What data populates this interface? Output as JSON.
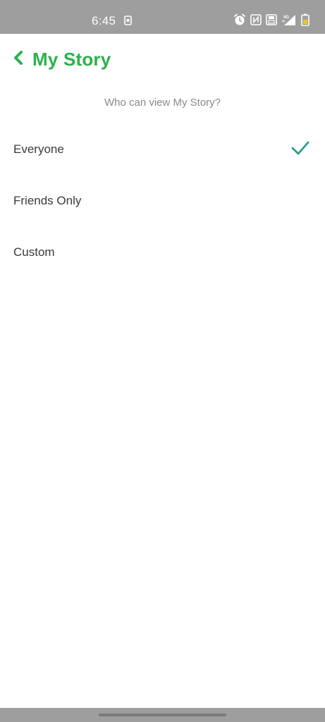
{
  "status_bar": {
    "time": "6:45",
    "icons": [
      "sim-card-icon",
      "alarm-icon",
      "nfc-icon",
      "storage-icon",
      "signal-4g-icon",
      "battery-icon"
    ],
    "background": "#9e9e9e"
  },
  "header": {
    "back_icon": "chevron-left-icon",
    "title": "My Story",
    "accent_color": "#2bb24c"
  },
  "prompt": "Who can view My Story?",
  "options": [
    {
      "label": "Everyone",
      "selected": true
    },
    {
      "label": "Friends Only",
      "selected": false
    },
    {
      "label": "Custom",
      "selected": false
    }
  ],
  "check_color": "#2a9d8f"
}
